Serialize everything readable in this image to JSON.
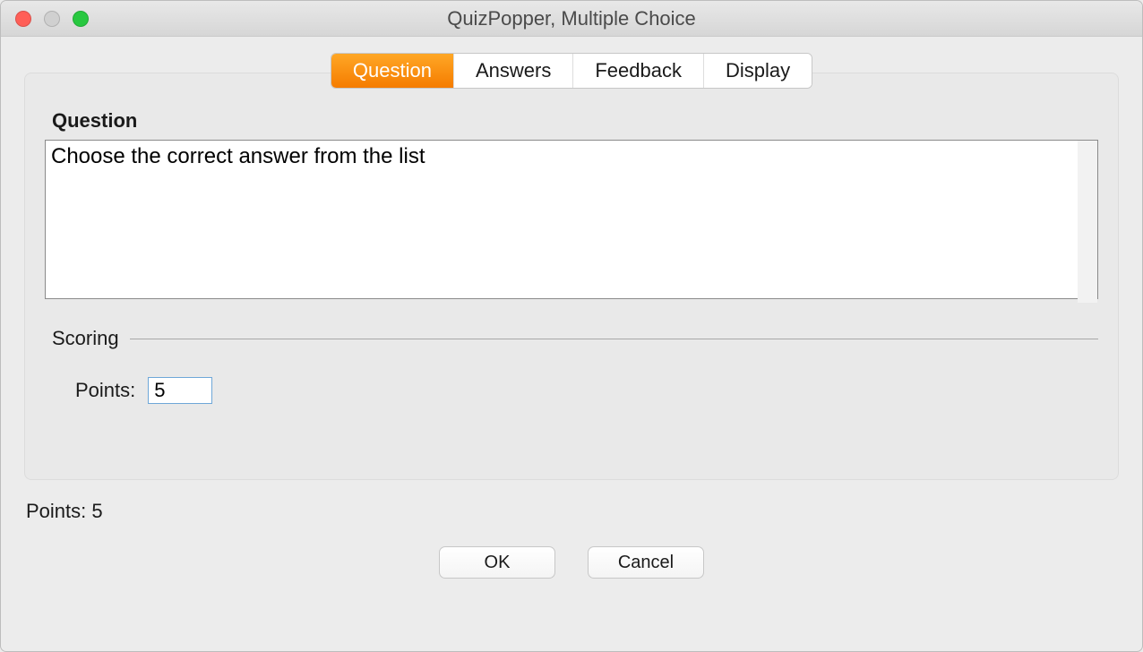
{
  "window": {
    "title": "QuizPopper, Multiple Choice"
  },
  "tabs": {
    "items": [
      {
        "label": "Question"
      },
      {
        "label": "Answers"
      },
      {
        "label": "Feedback"
      },
      {
        "label": "Display"
      }
    ]
  },
  "question": {
    "heading": "Question",
    "text": "Choose the correct answer from the list"
  },
  "scoring": {
    "heading": "Scoring",
    "points_label": "Points:",
    "points_value": "5"
  },
  "footer": {
    "points_text": "Points: 5"
  },
  "buttons": {
    "ok": "OK",
    "cancel": "Cancel"
  }
}
